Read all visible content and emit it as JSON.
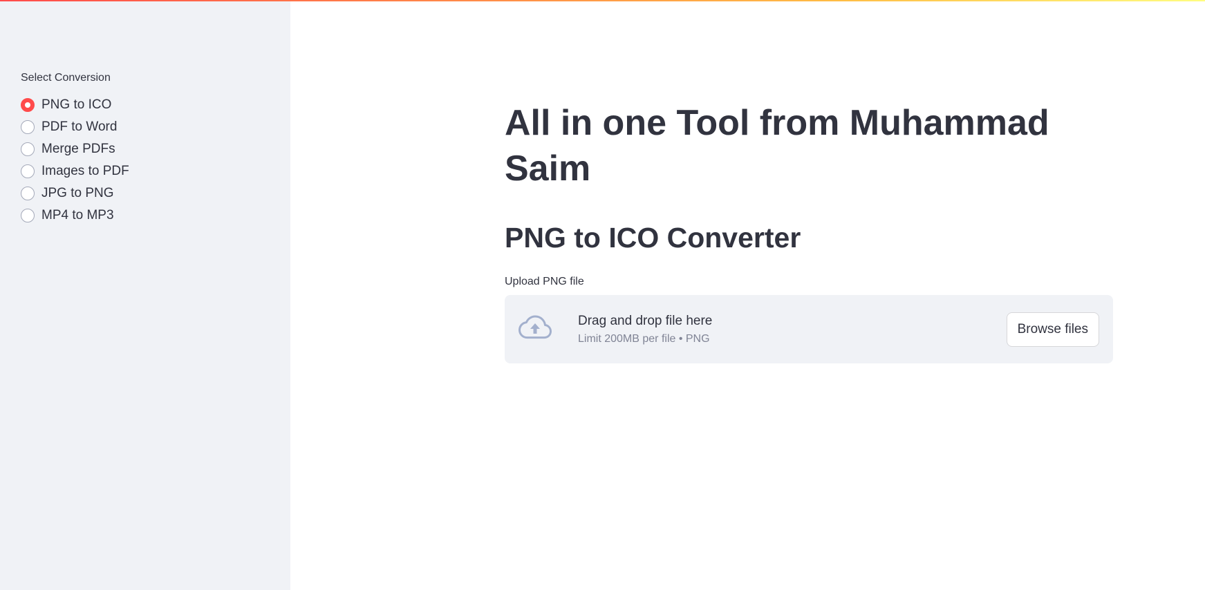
{
  "sidebar": {
    "radio_label": "Select Conversion",
    "options": [
      {
        "label": "PNG to ICO",
        "selected": true
      },
      {
        "label": "PDF to Word",
        "selected": false
      },
      {
        "label": "Merge PDFs",
        "selected": false
      },
      {
        "label": "Images to PDF",
        "selected": false
      },
      {
        "label": "JPG to PNG",
        "selected": false
      },
      {
        "label": "MP4 to MP3",
        "selected": false
      }
    ]
  },
  "main": {
    "title": "All in one Tool from Muhammad Saim",
    "section_title": "PNG to ICO Converter",
    "uploader": {
      "label": "Upload PNG file",
      "drag_text": "Drag and drop file here",
      "limit_text": "Limit 200MB per file • PNG",
      "browse_label": "Browse files",
      "icon": "cloud-upload-icon"
    }
  },
  "colors": {
    "accent": "#ff4b4b",
    "sidebar_bg": "#f0f2f6",
    "text": "#31333f",
    "muted_text": "#808495",
    "icon": "#a3b0cd"
  }
}
